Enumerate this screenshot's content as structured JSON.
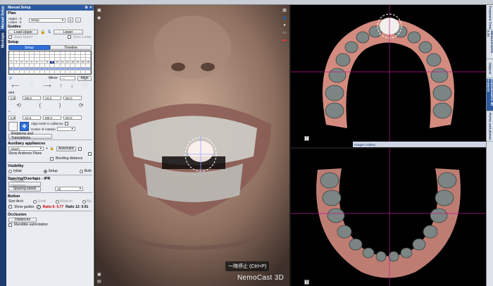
{
  "left_tabs": [
    "Manual Setup",
    "Mockups"
  ],
  "right_tabs": [
    "Treatment Time",
    "Measurements List",
    "Objects",
    "Cephalometric 3D Analysis",
    "Points and planes"
  ],
  "panel": {
    "title": "Manual Setup",
    "plan": {
      "heading": "Plan",
      "upper_label": "Upper : 0",
      "lower_label": "Lower : 0",
      "select_value": "Setup",
      "plus_label": "+",
      "minus_label": "-",
      "ref_label": "Ref 0"
    },
    "guides": {
      "heading": "Guides",
      "load_upper": "Load Upper",
      "lower": "Lower",
      "save_upper": "Save Upper",
      "save_lower": "Save Lower"
    },
    "setup": {
      "heading": "Setup",
      "tab_setup": "Setup",
      "tab_timeline": "Timeline",
      "mirror": "Mirror",
      "align": "Align",
      "mm_label": "mm",
      "deg_label": "°",
      "step1": "0.5",
      "step2": "0.5",
      "val_m0": "M0.0",
      "val_a0": "A0.0",
      "val_d0": "D0.0",
      "val_m0b": "M0.0",
      "val_a0b": "A0.0",
      "val_d0b": "D0.0",
      "align_collisions": "Align teeth in collisions",
      "center_rotation": "Center of rotation",
      "rot_trans": "Rotations and Translations"
    },
    "aux": {
      "heading": "Auxiliary appliances",
      "attach": "Attach",
      "automatic": "Automatic",
      "show_andrews": "Show Andrews Plane",
      "bonding": "Bonding distance"
    },
    "visibility": {
      "heading": "Visibility",
      "initial": "Initial",
      "setup": "Setup",
      "both": "Both"
    },
    "spacing": {
      "heading": "Spacing/Overlaps - IPR",
      "timeline_overlaps": "Timeline Overlaps",
      "spacing_labels": "Spacing labels",
      "spacing_value": "All"
    },
    "bolton": {
      "heading": "Bolton",
      "size_arch": "Size Arch",
      "small": "Small",
      "medium": "Medium",
      "big": "Big",
      "show_guides": "Show guides",
      "ratio6": "Ratio 6: 0.77",
      "ratio12": "Ratio 12: 0.91"
    },
    "occlusion": {
      "heading": "Occlusion",
      "distances": "Distances",
      "mandible": "Mandible autorotation"
    },
    "teeth_upper": [
      "1",
      "2",
      "3",
      "4",
      "5",
      "6",
      "7",
      "8",
      "9",
      "10",
      "11",
      "12",
      "13",
      "14",
      "15",
      "16"
    ]
  },
  "main_view": {
    "pause_label": "一時停止 (Ctrl+P)",
    "brand": "NemoCast 3D"
  },
  "upper_view": {
    "tag": "I",
    "gallery": "Images Gallery"
  },
  "lower_view": {
    "tag": "S"
  },
  "colors": {
    "accent": "#2c5aa0",
    "crosshair": "#c2188f",
    "gum": "#d38b80"
  }
}
